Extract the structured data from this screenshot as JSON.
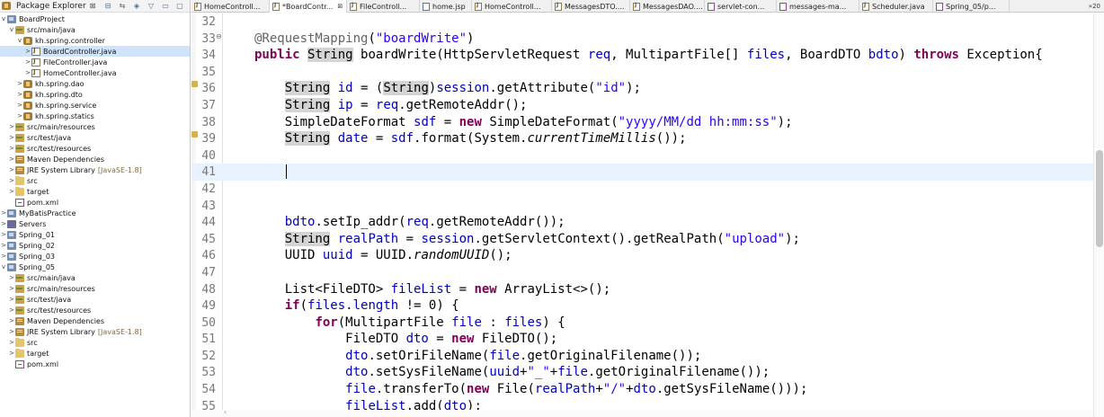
{
  "package_explorer": {
    "title": "Package Explorer",
    "close_glyph": "⊠",
    "tools": [
      "⊟",
      "⇆",
      "◈",
      "▽",
      "▭",
      "▢"
    ],
    "tree": [
      {
        "label": "BoardProject",
        "twisty": "v",
        "icon": "project",
        "indent": 0
      },
      {
        "label": "src/main/java",
        "twisty": "v",
        "icon": "srcfolder",
        "indent": 1
      },
      {
        "label": "kh.spring.controller",
        "twisty": "v",
        "icon": "package",
        "indent": 2
      },
      {
        "label": "BoardController.java",
        "twisty": ">",
        "icon": "java",
        "indent": 3,
        "selected": true
      },
      {
        "label": "FileController.java",
        "twisty": ">",
        "icon": "java",
        "indent": 3
      },
      {
        "label": "HomeController.java",
        "twisty": ">",
        "icon": "java",
        "indent": 3
      },
      {
        "label": "kh.spring.dao",
        "twisty": ">",
        "icon": "package",
        "indent": 2
      },
      {
        "label": "kh.spring.dto",
        "twisty": ">",
        "icon": "package",
        "indent": 2
      },
      {
        "label": "kh.spring.service",
        "twisty": ">",
        "icon": "package",
        "indent": 2
      },
      {
        "label": "kh.spring.statics",
        "twisty": ">",
        "icon": "package",
        "indent": 2
      },
      {
        "label": "src/main/resources",
        "twisty": ">",
        "icon": "srcfolder",
        "indent": 1
      },
      {
        "label": "src/test/java",
        "twisty": ">",
        "icon": "srcfolder",
        "indent": 1
      },
      {
        "label": "src/test/resources",
        "twisty": ">",
        "icon": "srcfolder",
        "indent": 1
      },
      {
        "label": "Maven Dependencies",
        "twisty": ">",
        "icon": "library",
        "indent": 1
      },
      {
        "label": "JRE System Library",
        "suffix": "[JavaSE-1.8]",
        "twisty": ">",
        "icon": "library",
        "indent": 1
      },
      {
        "label": "src",
        "twisty": ">",
        "icon": "folder",
        "indent": 1
      },
      {
        "label": "target",
        "twisty": ">",
        "icon": "folder",
        "indent": 1
      },
      {
        "label": "pom.xml",
        "twisty": "",
        "icon": "xml",
        "indent": 1
      },
      {
        "label": "MyBatisPractice",
        "twisty": ">",
        "icon": "project",
        "indent": 0
      },
      {
        "label": "Servers",
        "twisty": ">",
        "icon": "servers",
        "indent": 0
      },
      {
        "label": "Spring_01",
        "twisty": ">",
        "icon": "project",
        "indent": 0
      },
      {
        "label": "Spring_02",
        "twisty": ">",
        "icon": "project",
        "indent": 0
      },
      {
        "label": "Spring_03",
        "twisty": ">",
        "icon": "project",
        "indent": 0
      },
      {
        "label": "Spring_05",
        "twisty": "v",
        "icon": "project",
        "indent": 0
      },
      {
        "label": "src/main/java",
        "twisty": ">",
        "icon": "srcfolder",
        "indent": 1
      },
      {
        "label": "src/main/resources",
        "twisty": ">",
        "icon": "srcfolder",
        "indent": 1
      },
      {
        "label": "src/test/java",
        "twisty": ">",
        "icon": "srcfolder",
        "indent": 1
      },
      {
        "label": "src/test/resources",
        "twisty": ">",
        "icon": "srcfolder",
        "indent": 1
      },
      {
        "label": "Maven Dependencies",
        "twisty": ">",
        "icon": "library",
        "indent": 1
      },
      {
        "label": "JRE System Library",
        "suffix": "[JavaSE-1.8]",
        "twisty": ">",
        "icon": "library",
        "indent": 1
      },
      {
        "label": "src",
        "twisty": ">",
        "icon": "folder",
        "indent": 1
      },
      {
        "label": "target",
        "twisty": ">",
        "icon": "folder",
        "indent": 1
      },
      {
        "label": "pom.xml",
        "twisty": "",
        "icon": "xml",
        "indent": 1
      }
    ]
  },
  "editor_tabs": [
    {
      "label": "HomeControll...",
      "icon": "java"
    },
    {
      "label": "*BoardContr...",
      "icon": "java",
      "active": true,
      "close": "⊠"
    },
    {
      "label": "FileControll...",
      "icon": "java"
    },
    {
      "label": "home.jsp",
      "icon": "jsp"
    },
    {
      "label": "HomeControll...",
      "icon": "java"
    },
    {
      "label": "MessagesDTO....",
      "icon": "java"
    },
    {
      "label": "MessagesDAO....",
      "icon": "java"
    },
    {
      "label": "servlet-con...",
      "icon": "xml"
    },
    {
      "label": "messages-ma...",
      "icon": "xml"
    },
    {
      "label": "Scheduler.java",
      "icon": "java"
    },
    {
      "label": "Spring_05/p...",
      "icon": "xml"
    }
  ],
  "tab_overflow": "»20",
  "code_lines": [
    {
      "num": "32",
      "html": ""
    },
    {
      "num": "33",
      "fold": "⊖",
      "html": "<span class=\"ann\">@RequestMapping</span>(<span class=\"str\">\"boardWrite\"</span>)"
    },
    {
      "num": "34",
      "html": "<span class=\"kw\">public</span> <span class=\"occ\">String</span> boardWrite(HttpServletRequest <span class=\"fld\">req</span>, MultipartFile[] <span class=\"fld\">files</span>, BoardDTO <span class=\"fld\">bdto</span>) <span class=\"kw\">throws</span> Exception{"
    },
    {
      "num": "35",
      "html": ""
    },
    {
      "num": "36",
      "marker": true,
      "html": "    <span class=\"occ\">String</span> <span class=\"fld\">id</span> = (<span class=\"occ\">String</span>)<span class=\"fld\">session</span>.getAttribute(<span class=\"str\">\"id\"</span>);"
    },
    {
      "num": "37",
      "html": "    <span class=\"occ\">String</span> <span class=\"fld\">ip</span> = <span class=\"fld\">req</span>.getRemoteAddr();"
    },
    {
      "num": "38",
      "html": "    SimpleDateFormat <span class=\"fld\">sdf</span> = <span class=\"kw\">new</span> SimpleDateFormat(<span class=\"str\">\"yyyy/MM/dd hh:mm:ss\"</span>);"
    },
    {
      "num": "39",
      "marker": true,
      "html": "    <span class=\"occ\">String</span> <span class=\"fld\">date</span> = <span class=\"fld\">sdf</span>.format(System.<span class=\"it\">currentTimeMillis</span>());"
    },
    {
      "num": "40",
      "html": ""
    },
    {
      "num": "41",
      "current": true,
      "html": ""
    },
    {
      "num": "42",
      "html": ""
    },
    {
      "num": "43",
      "html": ""
    },
    {
      "num": "44",
      "html": "    <span class=\"fld\">bdto</span>.setIp_addr(<span class=\"fld\">req</span>.getRemoteAddr());"
    },
    {
      "num": "45",
      "html": "    <span class=\"occ\">String</span> <span class=\"fld\">realPath</span> = <span class=\"fld\">session</span>.getServletContext().getRealPath(<span class=\"str\">\"upload\"</span>);"
    },
    {
      "num": "46",
      "html": "    UUID <span class=\"fld\">uuid</span> = UUID.<span class=\"it\">randomUUID</span>();"
    },
    {
      "num": "47",
      "html": ""
    },
    {
      "num": "48",
      "html": "    List&lt;FileDTO&gt; <span class=\"fld\">fileList</span> = <span class=\"kw\">new</span> ArrayList&lt;&gt;();"
    },
    {
      "num": "49",
      "html": "    <span class=\"kw\">if</span>(<span class=\"fld\">files</span>.<span class=\"fld\">length</span> != 0) {"
    },
    {
      "num": "50",
      "html": "        <span class=\"kw\">for</span>(MultipartFile <span class=\"fld\">file</span> : <span class=\"fld\">files</span>) {"
    },
    {
      "num": "51",
      "html": "            FileDTO <span class=\"fld\">dto</span> = <span class=\"kw\">new</span> FileDTO();"
    },
    {
      "num": "52",
      "html": "            <span class=\"fld\">dto</span>.setOriFileName(<span class=\"fld\">file</span>.getOriginalFilename());"
    },
    {
      "num": "53",
      "html": "            <span class=\"fld\">dto</span>.setSysFileName(<span class=\"fld\">uuid</span>+<span class=\"str\">\"_\"</span>+<span class=\"fld\">file</span>.getOriginalFilename());"
    },
    {
      "num": "54",
      "html": "            <span class=\"fld\">file</span>.transferTo(<span class=\"kw\">new</span> File(<span class=\"fld\">realPath</span>+<span class=\"str\">\"/\"</span>+<span class=\"fld\">dto</span>.getSysFileName()));"
    },
    {
      "num": "55",
      "html": "            <span class=\"fld\">fileList</span>.add(<span class=\"fld\">dto</span>);"
    }
  ],
  "scrollbar": {
    "left_arrow": "‹"
  },
  "colors": {
    "keyword": "#7f0055",
    "string": "#2a00ff",
    "field": "#0000c0",
    "annotation": "#646464",
    "current_line": "#e8f2fe",
    "selection": "#cfe3fb"
  }
}
